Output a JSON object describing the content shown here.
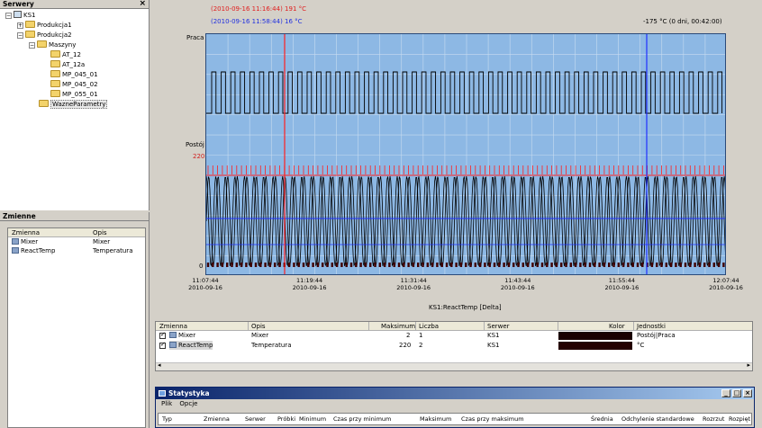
{
  "servers_panel": {
    "title": "Serwery",
    "close": "×",
    "tree": [
      {
        "label": "KS1",
        "level": 0,
        "kind": "server",
        "expander": "−"
      },
      {
        "label": "Produkcja1",
        "level": 1,
        "kind": "folder",
        "expander": "+"
      },
      {
        "label": "Produkcja2",
        "level": 1,
        "kind": "folder",
        "expander": "−"
      },
      {
        "label": "Maszyny",
        "level": 2,
        "kind": "folder",
        "expander": "−"
      },
      {
        "label": "AT_12",
        "level": 3,
        "kind": "folder",
        "expander": ""
      },
      {
        "label": "AT_12a",
        "level": 3,
        "kind": "folder",
        "expander": ""
      },
      {
        "label": "MP_045_01",
        "level": 3,
        "kind": "folder",
        "expander": ""
      },
      {
        "label": "MP_045_02",
        "level": 3,
        "kind": "folder",
        "expander": ""
      },
      {
        "label": "MP_055_01",
        "level": 3,
        "kind": "folder",
        "expander": ""
      },
      {
        "label": "WazneParametry",
        "level": 2,
        "kind": "folder",
        "expander": "",
        "selected": true
      }
    ]
  },
  "vars_panel": {
    "title": "Zmienne",
    "columns": [
      "Zmienna",
      "Opis"
    ],
    "rows": [
      {
        "name": "Mixer",
        "desc": "Mixer"
      },
      {
        "name": "ReactTemp",
        "desc": "Temperatura"
      }
    ]
  },
  "chart": {
    "cursor_red_label": "(2010-09-16 11:16:44) 191 °C",
    "cursor_blue_label": "(2010-09-16 11:58:44) 16 °C",
    "delta_label": "-175 °C (0 dni, 00:42:00)",
    "y_labels": {
      "top": "Praca",
      "mid": "Postój",
      "value": "220",
      "zero": "0"
    },
    "x_title": "KS1:ReactTemp [Delta]",
    "x_ticks": [
      {
        "time": "11:07:44",
        "date": "2010-09-16"
      },
      {
        "time": "11:19:44",
        "date": "2010-09-16"
      },
      {
        "time": "11:31:44",
        "date": "2010-09-16"
      },
      {
        "time": "11:43:44",
        "date": "2010-09-16"
      },
      {
        "time": "11:55:44",
        "date": "2010-09-16"
      },
      {
        "time": "12:07:44",
        "date": "2010-09-16"
      }
    ],
    "colors": {
      "plot_bg": "#8db8e4",
      "signal": "#000000",
      "red_cursor": "#ff2020",
      "blue_cursor": "#2030ff",
      "grid": "#c8dcf0"
    }
  },
  "legend_table": {
    "columns": [
      "Zmienna",
      "Opis",
      "Maksimum",
      "Liczba",
      "Serwer",
      "Kolor",
      "Jednostki"
    ],
    "rows": [
      {
        "name": "Mixer",
        "desc": "Mixer",
        "max": "2",
        "count": "1",
        "server": "KS1",
        "unit": "Postój|Praca"
      },
      {
        "name": "ReactTemp",
        "desc": "Temperatura",
        "max": "220",
        "count": "2",
        "server": "KS1",
        "unit": "°C"
      }
    ]
  },
  "stats_window": {
    "title": "Statystyka",
    "menu": [
      "Plik",
      "Opcje"
    ],
    "columns": [
      "Typ",
      "Zmienna",
      "Serwer",
      "Próbki",
      "Minimum",
      "Czas przy minimum",
      "Maksimum",
      "Czas przy maksimum",
      "Średnia",
      "Odchylenie standardowe",
      "Rozrzut",
      "Rozpięt"
    ],
    "buttons": {
      "minimize": "_",
      "maximize": "□",
      "close": "×"
    }
  }
}
